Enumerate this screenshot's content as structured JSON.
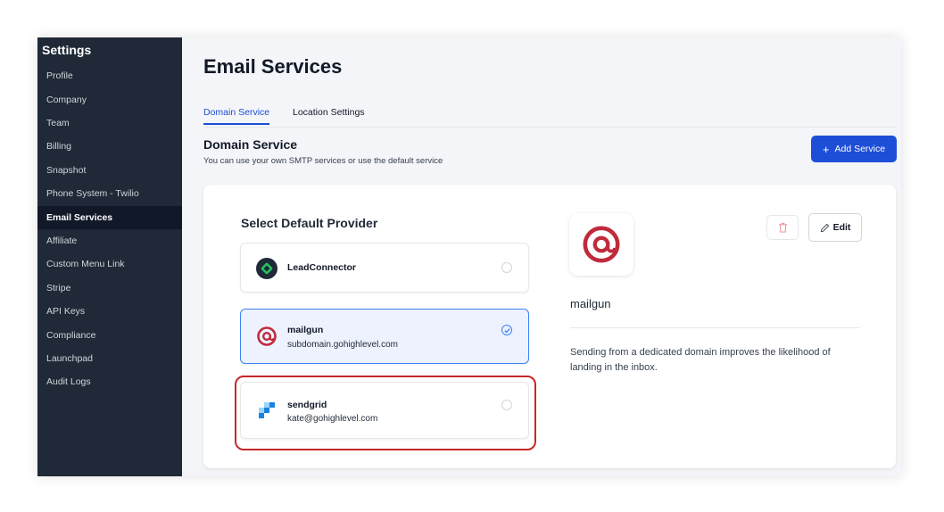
{
  "sidebar": {
    "title": "Settings",
    "items": [
      {
        "label": "Profile",
        "active": false
      },
      {
        "label": "Company",
        "active": false
      },
      {
        "label": "Team",
        "active": false
      },
      {
        "label": "Billing",
        "active": false
      },
      {
        "label": "Snapshot",
        "active": false
      },
      {
        "label": "Phone System - Twilio",
        "active": false
      },
      {
        "label": "Email Services",
        "active": true
      },
      {
        "label": "Affiliate",
        "active": false
      },
      {
        "label": "Custom Menu Link",
        "active": false
      },
      {
        "label": "Stripe",
        "active": false
      },
      {
        "label": "API Keys",
        "active": false
      },
      {
        "label": "Compliance",
        "active": false
      },
      {
        "label": "Launchpad",
        "active": false
      },
      {
        "label": "Audit Logs",
        "active": false
      }
    ]
  },
  "page": {
    "title": "Email Services",
    "tabs": [
      {
        "label": "Domain Service",
        "active": true
      },
      {
        "label": "Location Settings",
        "active": false
      }
    ],
    "section_title": "Domain Service",
    "section_subtitle": "You can use your own SMTP services or use the default service",
    "add_button": {
      "icon": "+",
      "label": "Add Service"
    }
  },
  "card": {
    "select_title": "Select Default Provider",
    "providers": [
      {
        "name": "LeadConnector",
        "subtitle": "",
        "selected": false,
        "icon": "leadconnector-logo"
      },
      {
        "name": "mailgun",
        "subtitle": "subdomain.gohighlevel.com",
        "selected": true,
        "icon": "mailgun-logo"
      },
      {
        "name": "sendgrid",
        "subtitle": "kate@gohighlevel.com",
        "selected": false,
        "icon": "sendgrid-logo"
      }
    ],
    "detail": {
      "name": "mailgun",
      "description": "Sending from a dedicated domain improves the likelihood of landing in the inbox.",
      "edit_label": "Edit",
      "delete_icon": "trash-icon"
    }
  },
  "colors": {
    "primary": "#1d4ed8",
    "sidebar_bg": "#1f2937",
    "mailgun_red": "#c02b3c",
    "highlight_red": "#c62828"
  }
}
